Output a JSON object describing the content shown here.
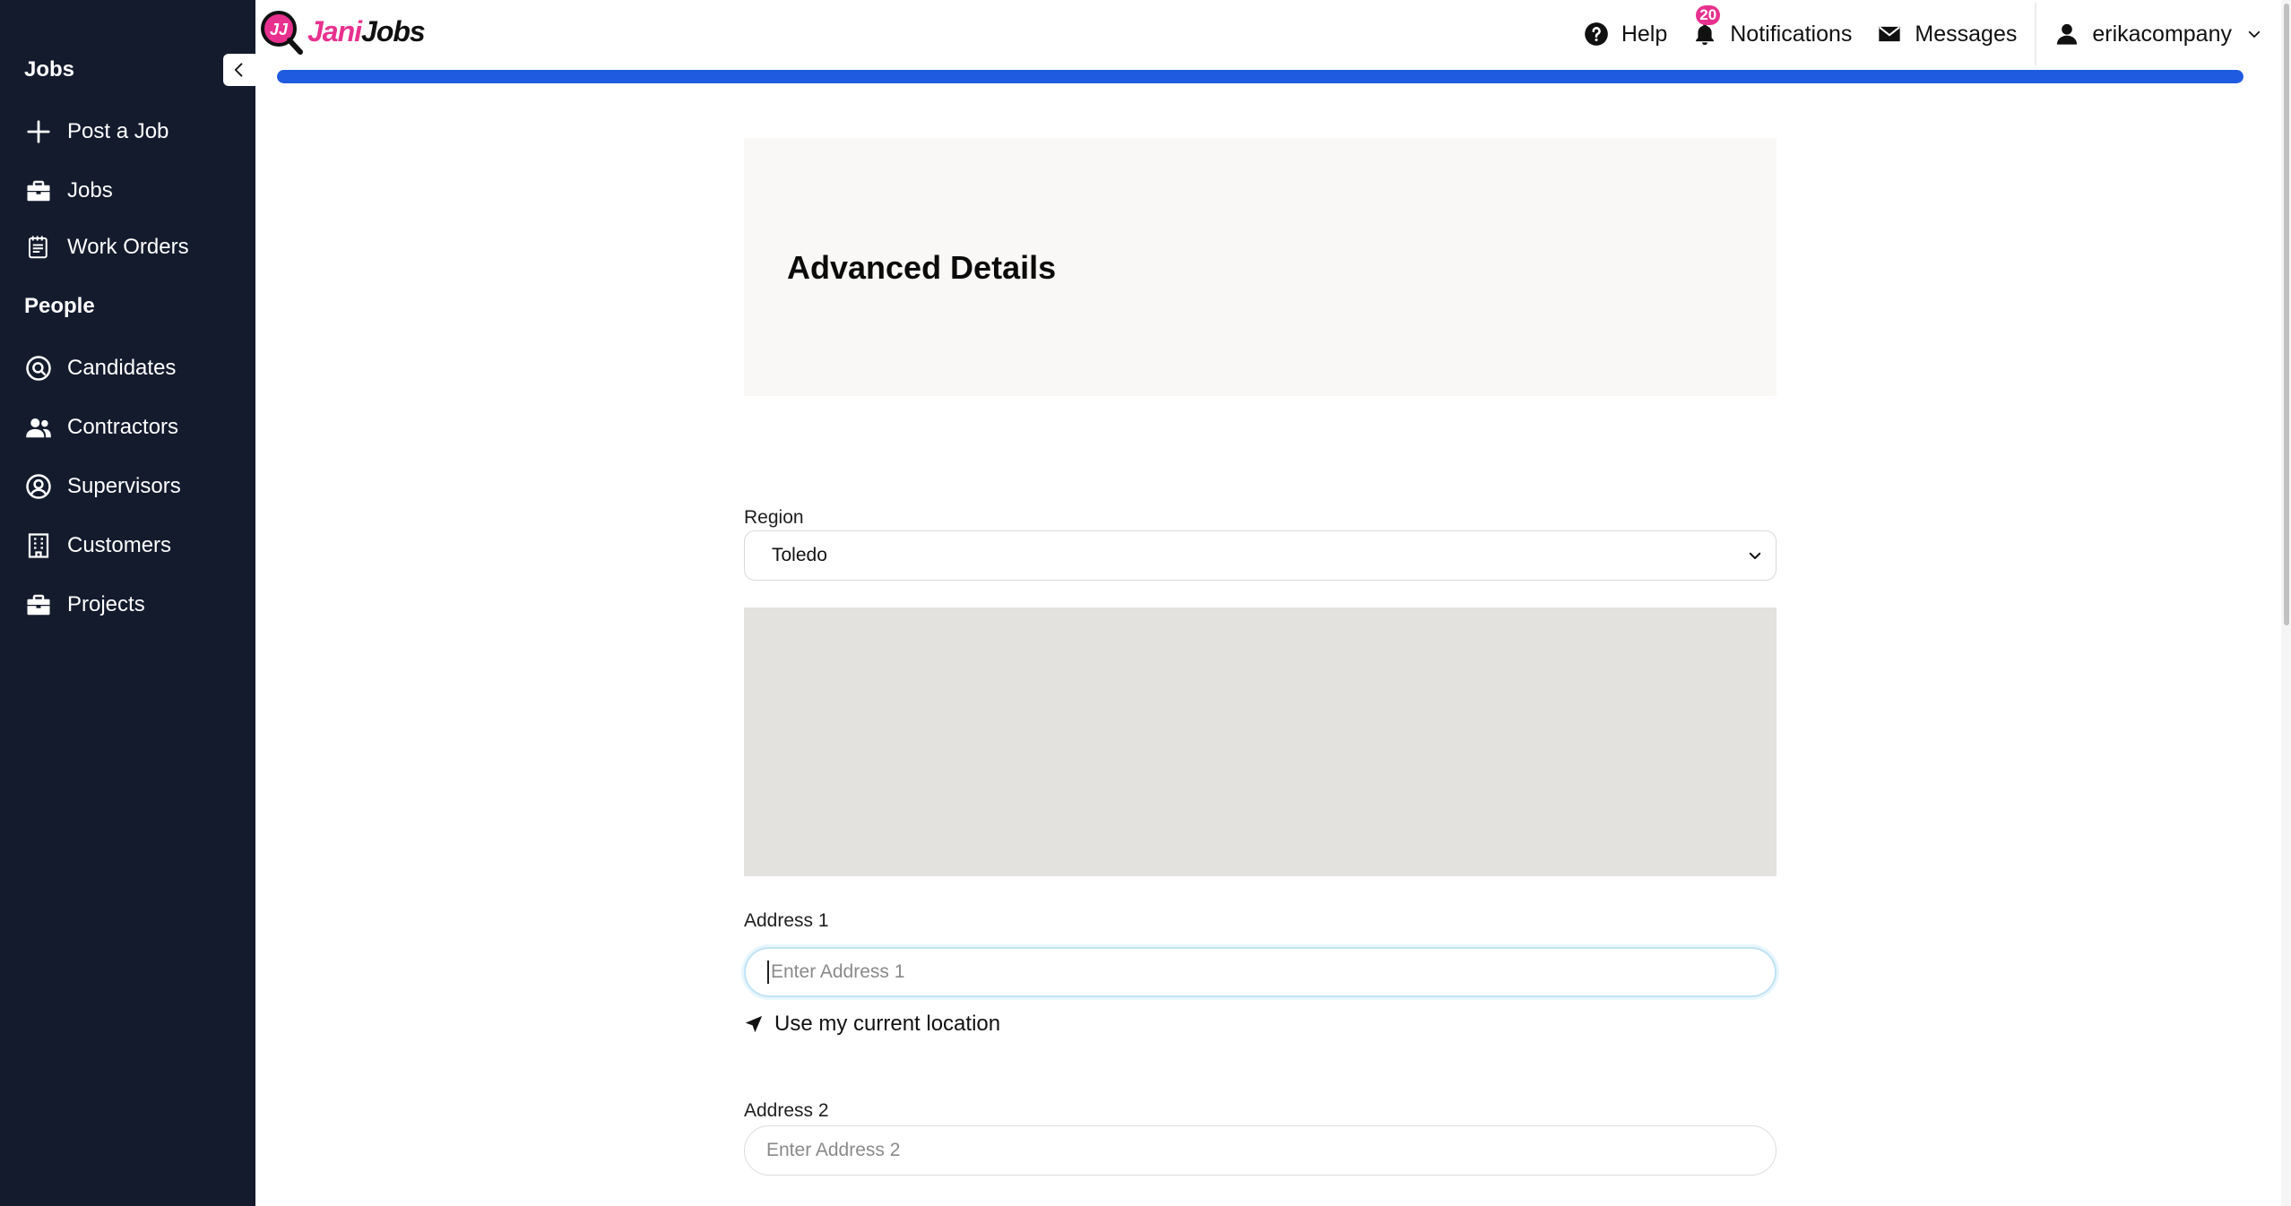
{
  "brand": {
    "logo_part1": "Jani",
    "logo_part2": "Jobs",
    "mark_text": "JJ",
    "pink": "#e8318f"
  },
  "sidebar": {
    "sections": [
      {
        "title": "Jobs",
        "items": [
          {
            "label": "Post a Job",
            "icon": "plus-icon"
          },
          {
            "label": "Jobs",
            "icon": "briefcase-icon"
          },
          {
            "label": "Work Orders",
            "icon": "notepad-icon"
          }
        ]
      },
      {
        "title": "People",
        "items": [
          {
            "label": "Candidates",
            "icon": "magnifier-circle-icon"
          },
          {
            "label": "Contractors",
            "icon": "people-icon"
          },
          {
            "label": "Supervisors",
            "icon": "user-circle-icon"
          },
          {
            "label": "Customers",
            "icon": "building-icon"
          },
          {
            "label": "Projects",
            "icon": "briefcase-icon"
          }
        ]
      }
    ],
    "background": "#141b2d"
  },
  "topnav": {
    "help": "Help",
    "notifications": "Notifications",
    "notifications_count": "20",
    "messages": "Messages",
    "user": "erikacompany"
  },
  "progress": {
    "percent": 100,
    "color": "#1f5be0"
  },
  "form": {
    "title": "Advanced Details",
    "region": {
      "label": "Region",
      "value": "Toledo"
    },
    "address1": {
      "label": "Address 1",
      "placeholder": "Enter Address 1"
    },
    "use_location": "Use my current location",
    "address2": {
      "label": "Address 2",
      "placeholder": "Enter Address 2"
    }
  }
}
